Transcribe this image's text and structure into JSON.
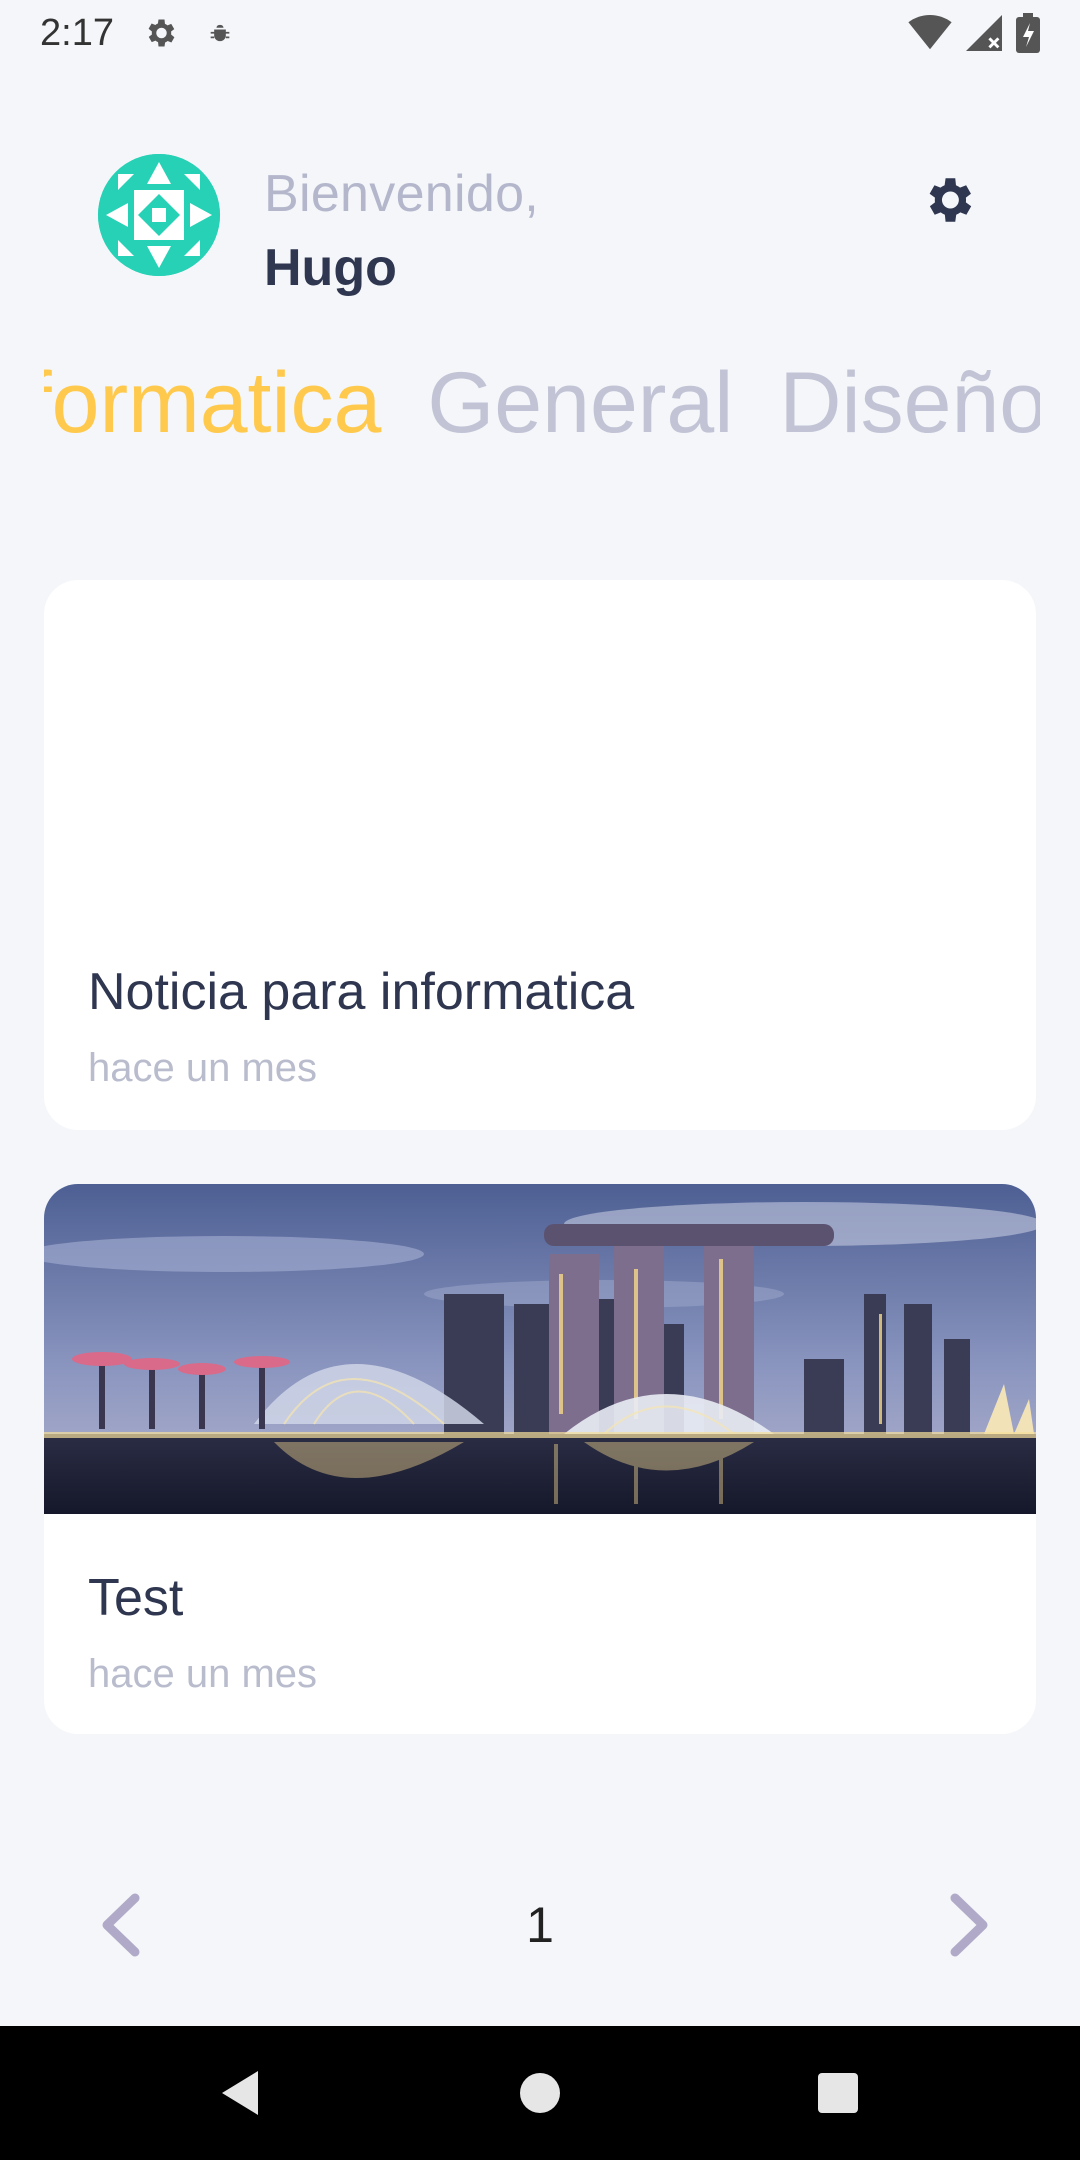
{
  "status_bar": {
    "time": "2:17"
  },
  "header": {
    "welcome_text": "Bienvenido,",
    "user_name": "Hugo"
  },
  "tabs": [
    {
      "label": "Informatica",
      "active": true
    },
    {
      "label": "General",
      "active": false
    },
    {
      "label": "Diseño industrial",
      "active": false
    }
  ],
  "news": [
    {
      "title": "Noticia para informatica",
      "date": "hace un mes",
      "has_image": false
    },
    {
      "title": "Test",
      "date": "hace un mes",
      "has_image": true
    }
  ],
  "pagination": {
    "current_page": "1"
  },
  "colors": {
    "background": "#f4f6f9",
    "active_tab": "#ffc94d",
    "inactive_tab": "#c2c4d6",
    "title_text": "#2f3650",
    "muted_text": "#b9bccd",
    "avatar": "#27d1b6"
  }
}
